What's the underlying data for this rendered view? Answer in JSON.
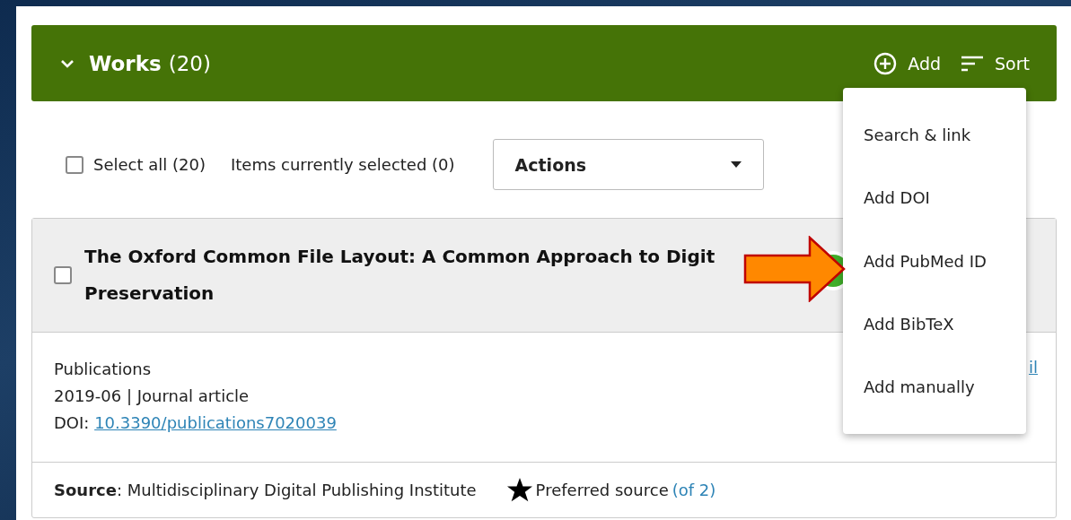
{
  "section": {
    "title": "Works",
    "count": "(20)",
    "expanded": true,
    "actions": [
      {
        "kind": "add",
        "label": "Add"
      },
      {
        "kind": "sort",
        "label": "Sort"
      }
    ]
  },
  "toolbar": {
    "select_all": {
      "label": "Select all (20)",
      "checked": false
    },
    "selected_count": "Items currently selected (0)",
    "actions_select": {
      "value": "Actions"
    }
  },
  "work": {
    "checked": false,
    "title_lines": [
      "The Oxford Common File Layout: A Common Approach to Digit",
      "Preservation"
    ],
    "journal": "Publications",
    "meta": "2019-06 | Journal article",
    "doi_label": "DOI:",
    "doi": "10.3390/publications7020039",
    "side_link": "il",
    "source": "**Source**: Multidisciplinary Digital Publishing Institute",
    "preferred": "Preferred source",
    "preferred_count": "(of 2)"
  },
  "add_menu": {
    "items": [
      {
        "label": "Search & link"
      },
      {
        "label": "Add DOI"
      },
      {
        "label": "Add PubMed ID"
      },
      {
        "label": "Add BibTeX"
      },
      {
        "label": "Add manually"
      }
    ]
  }
}
